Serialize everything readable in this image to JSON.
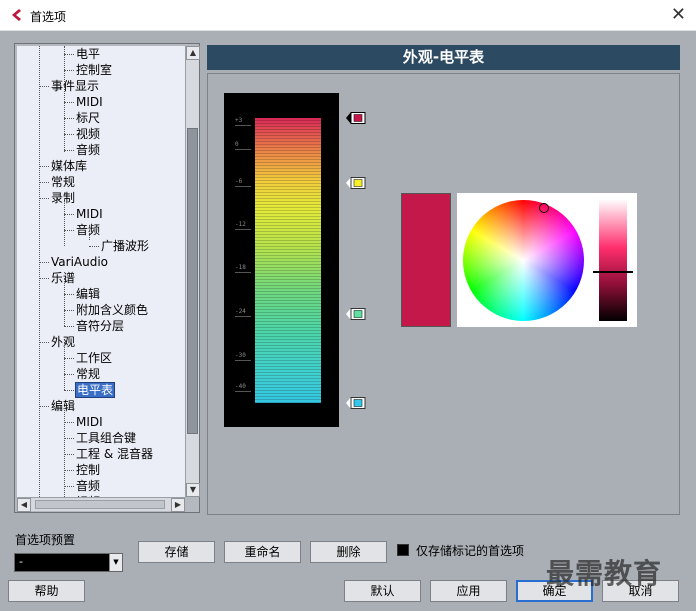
{
  "window": {
    "title": "首选项",
    "close_glyph": "✕"
  },
  "tree": {
    "items": [
      {
        "label": "电平",
        "level": 2
      },
      {
        "label": "控制室",
        "level": 2
      },
      {
        "label": "事件显示",
        "level": 1
      },
      {
        "label": "MIDI",
        "level": 2
      },
      {
        "label": "标尺",
        "level": 2
      },
      {
        "label": "视频",
        "level": 2
      },
      {
        "label": "音频",
        "level": 2
      },
      {
        "label": "媒体库",
        "level": 1
      },
      {
        "label": "常规",
        "level": 1
      },
      {
        "label": "录制",
        "level": 1
      },
      {
        "label": "MIDI",
        "level": 2
      },
      {
        "label": "音频",
        "level": 2
      },
      {
        "label": "广播波形",
        "level": 3
      },
      {
        "label": "VariAudio",
        "level": 1
      },
      {
        "label": "乐谱",
        "level": 1
      },
      {
        "label": "编辑",
        "level": 2
      },
      {
        "label": "附加含义颜色",
        "level": 2
      },
      {
        "label": "音符分层",
        "level": 2
      },
      {
        "label": "外观",
        "level": 1
      },
      {
        "label": "工作区",
        "level": 2
      },
      {
        "label": "常规",
        "level": 2
      },
      {
        "label": "电平表",
        "level": 2,
        "selected": true
      },
      {
        "label": "编辑",
        "level": 1
      },
      {
        "label": "MIDI",
        "level": 2
      },
      {
        "label": "工具组合键",
        "level": 2
      },
      {
        "label": "工程 & 混音器",
        "level": 2
      },
      {
        "label": "控制",
        "level": 2
      },
      {
        "label": "音频",
        "level": 2
      },
      {
        "label": "视频",
        "level": 2
      }
    ]
  },
  "section": {
    "title": "外观-电平表"
  },
  "meter": {
    "scale_labels": [
      "+3",
      "0",
      "-6",
      "-12",
      "-18",
      "-24",
      "-30",
      "-40"
    ],
    "markers": [
      {
        "name": "marker-top",
        "color": "#c4174a"
      },
      {
        "name": "marker-yellow",
        "color": "#f5f02a"
      },
      {
        "name": "marker-green",
        "color": "#5fe0a0"
      },
      {
        "name": "marker-cyan",
        "color": "#33c8e8"
      }
    ]
  },
  "color_picker": {
    "selected_color": "#c4174a"
  },
  "presets": {
    "label": "首选项预置",
    "selected": "-",
    "store_label": "存储",
    "rename_label": "重命名",
    "delete_label": "删除",
    "only_marked_label": "仅存储标记的首选项"
  },
  "footer": {
    "help_label": "帮助",
    "default_label": "默认",
    "apply_label": "应用",
    "ok_label": "确定",
    "cancel_label": "取消"
  },
  "watermark": {
    "text": "最需教育"
  }
}
